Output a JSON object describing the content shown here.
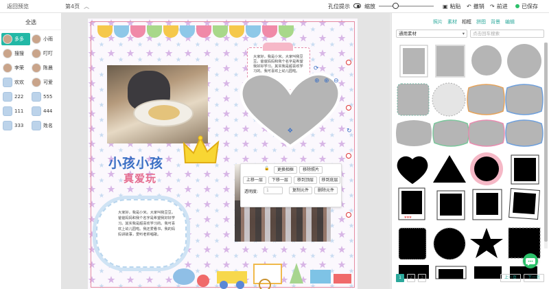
{
  "topbar": {
    "back_label": "返回预览",
    "page_indicator": "第4页",
    "hole_hint_label": "孔位提示",
    "zoom_label": "缩放",
    "zoom_level": 0.3,
    "paste_label": "粘贴",
    "undo_label": "撤销",
    "redo_label": "前进",
    "saved_label": "已保存"
  },
  "sidebar": {
    "select_all_label": "全选",
    "members": [
      {
        "name": "多多",
        "active": true,
        "avatar": "photo"
      },
      {
        "name": "小雨",
        "active": false,
        "avatar": "photo"
      },
      {
        "name": "搜搜",
        "active": false,
        "avatar": "photo"
      },
      {
        "name": "叮叮",
        "active": false,
        "avatar": "photo"
      },
      {
        "name": "李荣",
        "active": false,
        "avatar": "photo"
      },
      {
        "name": "陈晨",
        "active": false,
        "avatar": "photo"
      },
      {
        "name": "欢欢",
        "active": false,
        "avatar": "elephant"
      },
      {
        "name": "可爱",
        "active": false,
        "avatar": "photo"
      },
      {
        "name": "222",
        "active": false,
        "avatar": "elephant"
      },
      {
        "name": "555",
        "active": false,
        "avatar": "elephant"
      },
      {
        "name": "111",
        "active": false,
        "avatar": "elephant"
      },
      {
        "name": "444",
        "active": false,
        "avatar": "elephant"
      },
      {
        "name": "333",
        "active": false,
        "avatar": "elephant"
      },
      {
        "name": "姓名",
        "active": false,
        "avatar": "elephant"
      }
    ]
  },
  "canvas": {
    "title": "小孩小孩",
    "subtitle": "真爱玩",
    "pink_card_text": "大家好，我是小米。大家叫我豆豆。爸爸妈妈和我个名字是希望我好好学习。其实我是超喜欢学习的。我可喜欢上幼儿园啦。",
    "cloud_text": "大家好，我是小米。大家叫我豆豆。爸爸妈妈和我个名字是希望我好好学习。其实我是超喜欢学习的。我可喜欢上幼儿园啦。我还爱看书，我的妈妈讲故事，爱听老师唱歌。",
    "popup": {
      "lock_icon": "lock-icon",
      "replace_frame": "更换相框",
      "remove_photo": "移除照片",
      "up_one_layer": "上移一层",
      "down_one_layer": "下移一层",
      "to_top": "移到顶层",
      "to_bottom": "移到底层",
      "opacity_label": "透明度:",
      "opacity_value": "1",
      "copy_element": "复制元件",
      "delete_element": "删除元件"
    }
  },
  "rpanel": {
    "tabs": [
      {
        "label": "照片",
        "active": false
      },
      {
        "label": "素材",
        "active": false
      },
      {
        "label": "相框",
        "active": true
      },
      {
        "label": "拼图",
        "active": false
      },
      {
        "label": "背景",
        "active": false
      },
      {
        "label": "编辑",
        "active": false
      }
    ],
    "select_value": "通用素材",
    "search_placeholder": "点击回车搜索",
    "pages": [
      "1",
      "2",
      "3"
    ],
    "prev_label": "上一页",
    "next_label": "下一页"
  },
  "colors": {
    "accent": "#2aa89b",
    "active_member": "#22b8a6",
    "saved": "#2cc06a",
    "title_blue": "#3a6fc4",
    "title_pink": "#e56c8f"
  }
}
